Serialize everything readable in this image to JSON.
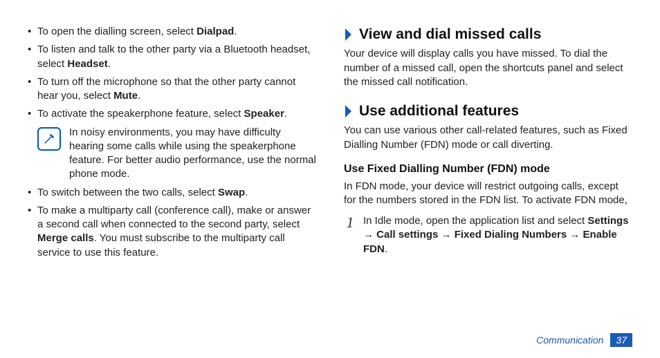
{
  "left": {
    "bullets_top": [
      {
        "pre": "To open the dialling screen, select ",
        "bold": "Dialpad",
        "post": "."
      },
      {
        "pre": "To listen and talk to the other party via a Bluetooth headset, select ",
        "bold": "Headset",
        "post": "."
      },
      {
        "pre": "To turn off the microphone so that the other party cannot hear you, select ",
        "bold": "Mute",
        "post": "."
      },
      {
        "pre": "To activate the speakerphone feature, select ",
        "bold": "Speaker",
        "post": "."
      }
    ],
    "note": "In noisy environments, you may have difficulty hearing some calls while using the speakerphone feature. For better audio performance, use the normal phone mode.",
    "bullets_bottom": [
      {
        "pre": "To switch between the two calls, select ",
        "bold": "Swap",
        "post": "."
      },
      {
        "pre": "To make a multiparty call (conference call), make or answer a second call when connected to the second party, select ",
        "bold": "Merge calls",
        "post": ". You must subscribe to the multiparty call service to use this feature."
      }
    ]
  },
  "right": {
    "section1": {
      "title": "View and dial missed calls",
      "body": "Your device will display calls you have missed. To dial the number of a missed call, open the shortcuts panel and select the missed call notification."
    },
    "section2": {
      "title": "Use additional features",
      "body": "You can use various other call-related features, such as Fixed Dialling Number (FDN) mode or call diverting.",
      "subhead": "Use Fixed Dialling Number (FDN) mode",
      "subbody": "In FDN mode, your device will restrict outgoing calls, except for the numbers stored in the FDN list. To activate FDN mode,",
      "step_num": "1",
      "step_pre": "In Idle mode, open the application list and select ",
      "step_bold": "Settings → Call settings → Fixed Dialing Numbers → Enable FDN",
      "step_post": "."
    }
  },
  "footer": {
    "category": "Communication",
    "page": "37"
  }
}
